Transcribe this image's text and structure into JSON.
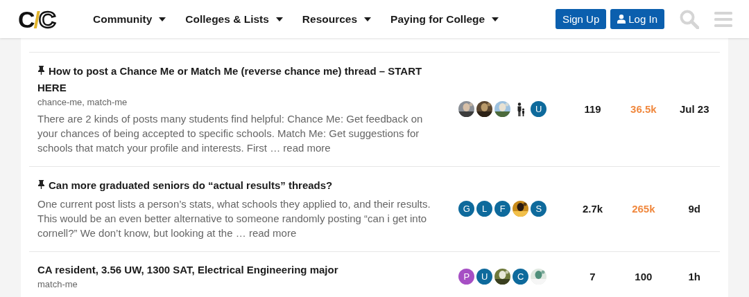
{
  "header": {
    "logo": "C/C",
    "nav": [
      {
        "label": "Community"
      },
      {
        "label": "Colleges & Lists"
      },
      {
        "label": "Resources"
      },
      {
        "label": "Paying for College"
      }
    ],
    "buttons": [
      {
        "label": "Sign Up",
        "kind": "plain"
      },
      {
        "label": "Log In",
        "kind": "user"
      }
    ]
  },
  "topics": [
    {
      "title": "How to post a Chance Me or Match Me (reverse chance me) thread – START HERE",
      "pinned": true,
      "tags": "chance-me, match-me",
      "excerpt": "There are 2 kinds of posts many students find helpful: Chance Me: Get feedback on your chances of being accepted to specific schools. Match Me: Get suggestions for schools that match your profile and interests. First …",
      "link": "read more",
      "posters": [
        {
          "kind": "picture"
        },
        {
          "kind": "picture"
        },
        {
          "kind": "picture"
        },
        {
          "kind": "figure"
        },
        {
          "kind": "letter",
          "letter": "U",
          "color": "#0e6a9c"
        }
      ],
      "replies": "119",
      "views": "36.5k",
      "hot": true,
      "activity": "Jul 23"
    },
    {
      "title": "Can more graduated seniors do “actual results” threads?",
      "pinned": true,
      "excerpt": "One current post lists a person’s stats, what schools they applied to, and their results. This would be an even better alternative to someone randomly posting “can i get into cornell?” We don’t know, but looking at the …",
      "link": "read more",
      "posters": [
        {
          "kind": "letter",
          "letter": "G",
          "color": "#0e6a9c"
        },
        {
          "kind": "letter",
          "letter": "L",
          "color": "#0e6a9c"
        },
        {
          "kind": "letter",
          "letter": "F",
          "color": "#0e6a9c"
        },
        {
          "kind": "picture"
        },
        {
          "kind": "letter",
          "letter": "S",
          "color": "#0e6a9c"
        }
      ],
      "replies": "2.7k",
      "views": "265k",
      "hot": true,
      "activity": "9d"
    },
    {
      "title": "CA resident, 3.56 UW, 1300 SAT, Electrical Engineering major",
      "pinned": false,
      "tags": "match-me",
      "posters": [
        {
          "kind": "letter",
          "letter": "P",
          "color": "#a64fc4"
        },
        {
          "kind": "letter",
          "letter": "U",
          "color": "#0e6a9c"
        },
        {
          "kind": "picture"
        },
        {
          "kind": "letter",
          "letter": "C",
          "color": "#0e6a9c"
        },
        {
          "kind": "picture"
        }
      ],
      "replies": "7",
      "views": "100",
      "hot": false,
      "activity": "1h"
    }
  ]
}
